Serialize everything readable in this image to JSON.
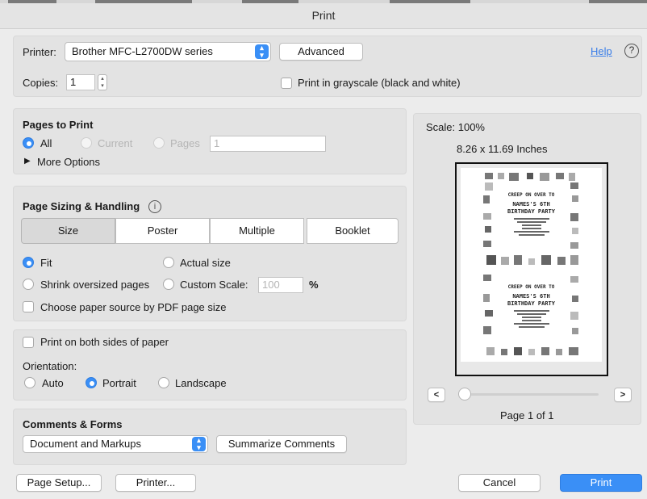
{
  "window": {
    "title": "Print"
  },
  "printer": {
    "label": "Printer:",
    "value": "Brother MFC-L2700DW series",
    "advanced": "Advanced",
    "help": "Help",
    "help_icon": "?"
  },
  "copies": {
    "label": "Copies:",
    "value": "1",
    "grayscale": "Print in grayscale (black and white)"
  },
  "pages_to_print": {
    "title": "Pages to Print",
    "all": "All",
    "current": "Current",
    "pages": "Pages",
    "pages_value": "1",
    "more_options": "More Options",
    "selected": "All"
  },
  "sizing": {
    "title": "Page Sizing & Handling",
    "info_icon": "i",
    "tabs": [
      "Size",
      "Poster",
      "Multiple",
      "Booklet"
    ],
    "selected_tab": "Size",
    "fit": "Fit",
    "actual_size": "Actual size",
    "shrink": "Shrink oversized pages",
    "custom_scale": "Custom Scale:",
    "custom_scale_value": "100",
    "percent": "%",
    "paper_source": "Choose paper source by PDF page size",
    "selected": "Fit"
  },
  "orientation": {
    "duplex": "Print on both sides of paper",
    "label": "Orientation:",
    "auto": "Auto",
    "portrait": "Portrait",
    "landscape": "Landscape",
    "selected": "Portrait"
  },
  "comments": {
    "title": "Comments & Forms",
    "value": "Document and Markups",
    "summarize": "Summarize Comments"
  },
  "preview": {
    "scale": "Scale: 100%",
    "size": "8.26 x 11.69 Inches",
    "page_info": "Page 1 of 1",
    "prev": "<",
    "next": ">",
    "invite": {
      "line1": "CREEP ON OVER TO",
      "line2": "NAMES'S 6TH",
      "line3": "BIRTHDAY PARTY"
    }
  },
  "footer": {
    "page_setup": "Page Setup...",
    "printer": "Printer...",
    "cancel": "Cancel",
    "print": "Print"
  },
  "colors": {
    "accent": "#3a8ff6"
  }
}
